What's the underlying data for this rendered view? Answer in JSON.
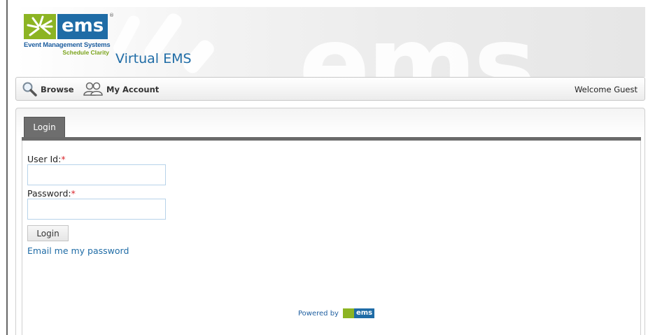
{
  "header": {
    "logo_text": "ems",
    "logo_registered": "®",
    "logo_subtitle": "Event Management Systems",
    "logo_tagline": "Schedule Clarity",
    "app_title": "Virtual EMS",
    "background_word": "ems"
  },
  "nav": {
    "items": [
      {
        "label": "Browse",
        "icon": "magnifier-icon"
      },
      {
        "label": "My Account",
        "icon": "users-icon"
      }
    ],
    "welcome": "Welcome Guest"
  },
  "login": {
    "tab_label": "Login",
    "user_id_label": "User Id:",
    "password_label": "Password:",
    "required_marker": "*",
    "user_id_value": "",
    "password_value": "",
    "submit_label": "Login",
    "email_link": "Email me my password"
  },
  "footer": {
    "powered_by": "Powered by",
    "powered_logo": "ems"
  },
  "colors": {
    "brand_blue": "#1f6ca6",
    "brand_green": "#8cb423",
    "required_red": "#d9262d",
    "tab_gray": "#6e6e6e"
  }
}
